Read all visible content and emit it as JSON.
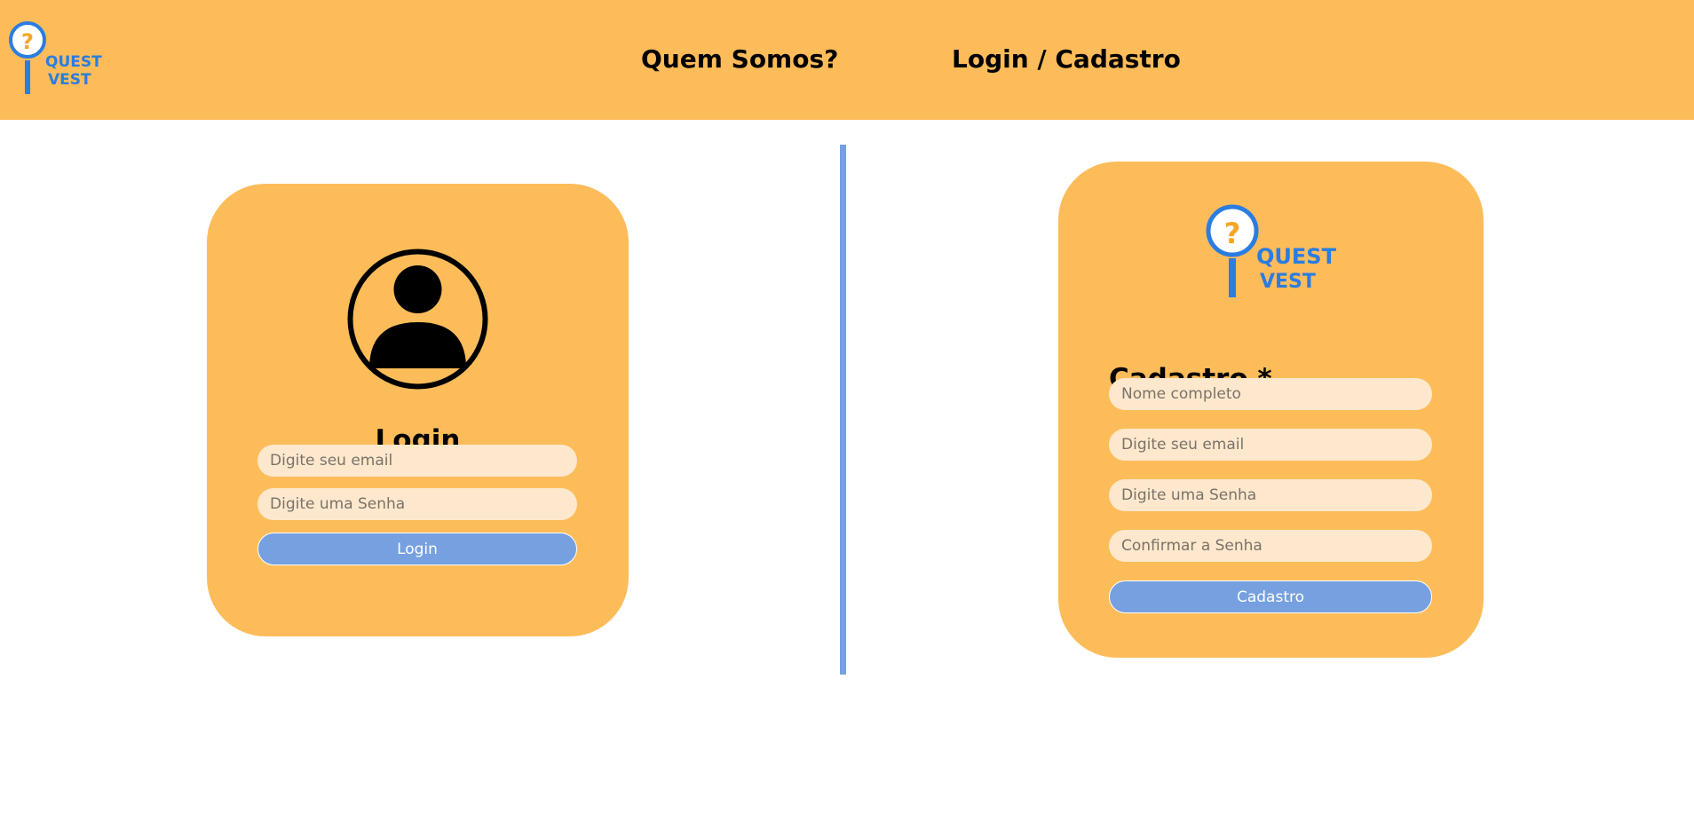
{
  "brand": {
    "line1": "QUEST",
    "line2": "VEST"
  },
  "nav": {
    "about": "Quem Somos?",
    "login": "Login / Cadastro"
  },
  "login": {
    "title": "Login",
    "email_placeholder": "Digite seu email",
    "password_placeholder": "Digite uma Senha",
    "button": "Login"
  },
  "signup": {
    "title": "Cadastro *",
    "name_placeholder": "Nome completo",
    "email_placeholder": "Digite seu email",
    "password_placeholder": "Digite uma Senha",
    "confirm_placeholder": "Confirmar a Senha",
    "button": "Cadastro"
  },
  "colors": {
    "header_bg": "#fdbc5a",
    "card_bg": "#fdbc5a",
    "input_bg": "#fde8cd",
    "accent_blue": "#76a0df",
    "logo_blue": "#2a7de1",
    "question_orange": "#f5a623"
  }
}
